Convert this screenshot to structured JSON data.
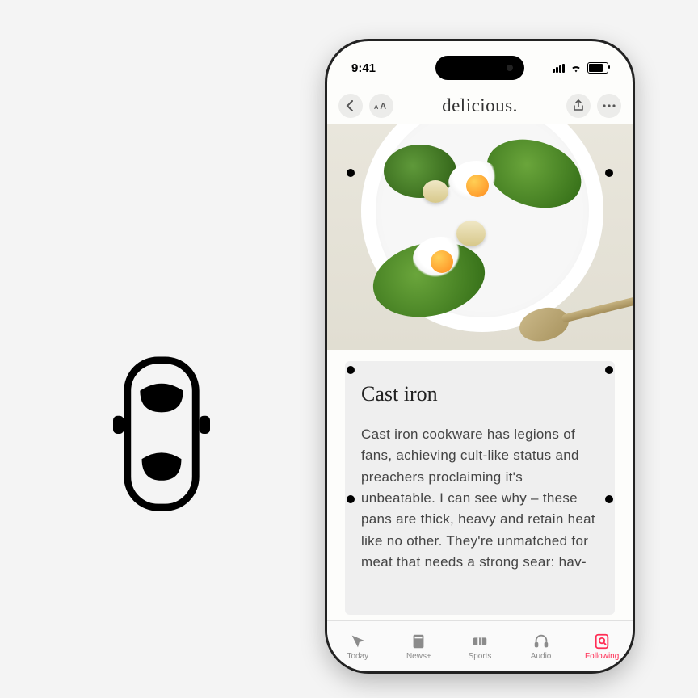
{
  "status": {
    "time": "9:41"
  },
  "nav": {
    "brand": "delicious."
  },
  "article": {
    "heading": "Cast iron",
    "body": "Cast iron cookware has legions of fans, achieving cult-like status and preachers proclaiming it's unbeatable. I can see why – these pans are thick, heavy and retain heat like no other. They're unmatched for meat that needs a strong sear: hav-"
  },
  "tabs": [
    {
      "label": "Today"
    },
    {
      "label": "News+"
    },
    {
      "label": "Sports"
    },
    {
      "label": "Audio"
    },
    {
      "label": "Following"
    }
  ],
  "active_tab_index": 4
}
